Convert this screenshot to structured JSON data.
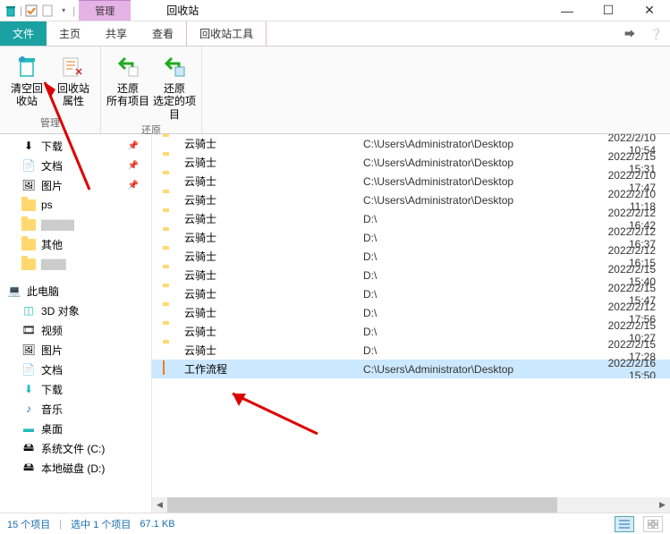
{
  "titlebar": {
    "context_label": "管理",
    "window_title": "回收站"
  },
  "menu": {
    "file": "文件",
    "home": "主页",
    "share": "共享",
    "view": "查看",
    "recycle_tools": "回收站工具"
  },
  "ribbon": {
    "group_manage": "管理",
    "group_restore": "还原",
    "empty_bin_1": "清空回",
    "empty_bin_2": "收站",
    "bin_props_1": "回收站",
    "bin_props_2": "属性",
    "restore_all_1": "还原",
    "restore_all_2": "所有项目",
    "restore_sel_1": "还原",
    "restore_sel_2": "选定的项目"
  },
  "nav": {
    "downloads": "下载",
    "documents": "文档",
    "pictures": "图片",
    "ps": "ps",
    "other": "其他",
    "this_pc": "此电脑",
    "objects3d": "3D 对象",
    "videos": "视频",
    "pictures2": "图片",
    "documents2": "文档",
    "downloads2": "下载",
    "music": "音乐",
    "desktop": "桌面",
    "cdrive": "系统文件 (C:)",
    "ddrive": "本地磁盘 (D:)"
  },
  "files": [
    {
      "name": "云骑士",
      "location": "C:\\Users\\Administrator\\Desktop",
      "date": "2022/2/10 10:54",
      "type": "folder"
    },
    {
      "name": "云骑士",
      "location": "C:\\Users\\Administrator\\Desktop",
      "date": "2022/2/15 15:31",
      "type": "folder"
    },
    {
      "name": "云骑士",
      "location": "C:\\Users\\Administrator\\Desktop",
      "date": "2022/2/10 17:47",
      "type": "folder"
    },
    {
      "name": "云骑士",
      "location": "C:\\Users\\Administrator\\Desktop",
      "date": "2022/2/10 11:18",
      "type": "folder"
    },
    {
      "name": "云骑士",
      "location": "D:\\",
      "date": "2022/2/12 16:42",
      "type": "folder"
    },
    {
      "name": "云骑士",
      "location": "D:\\",
      "date": "2022/2/12 16:37",
      "type": "folder"
    },
    {
      "name": "云骑士",
      "location": "D:\\",
      "date": "2022/2/12 16:15",
      "type": "folder"
    },
    {
      "name": "云骑士",
      "location": "D:\\",
      "date": "2022/2/15 15:40",
      "type": "folder"
    },
    {
      "name": "云骑士",
      "location": "D:\\",
      "date": "2022/2/15 15:47",
      "type": "folder"
    },
    {
      "name": "云骑士",
      "location": "D:\\",
      "date": "2022/2/12 17:56",
      "type": "folder"
    },
    {
      "name": "云骑士",
      "location": "D:\\",
      "date": "2022/2/15 10:27",
      "type": "folder"
    },
    {
      "name": "云骑士",
      "location": "D:\\",
      "date": "2022/2/15 17:28",
      "type": "folder"
    },
    {
      "name": "工作流程",
      "location": "C:\\Users\\Administrator\\Desktop",
      "date": "2022/2/16 15:50",
      "type": "doc",
      "selected": true
    }
  ],
  "status": {
    "count": "15 个项目",
    "selection": "选中 1 个项目",
    "size": "67.1 KB"
  }
}
